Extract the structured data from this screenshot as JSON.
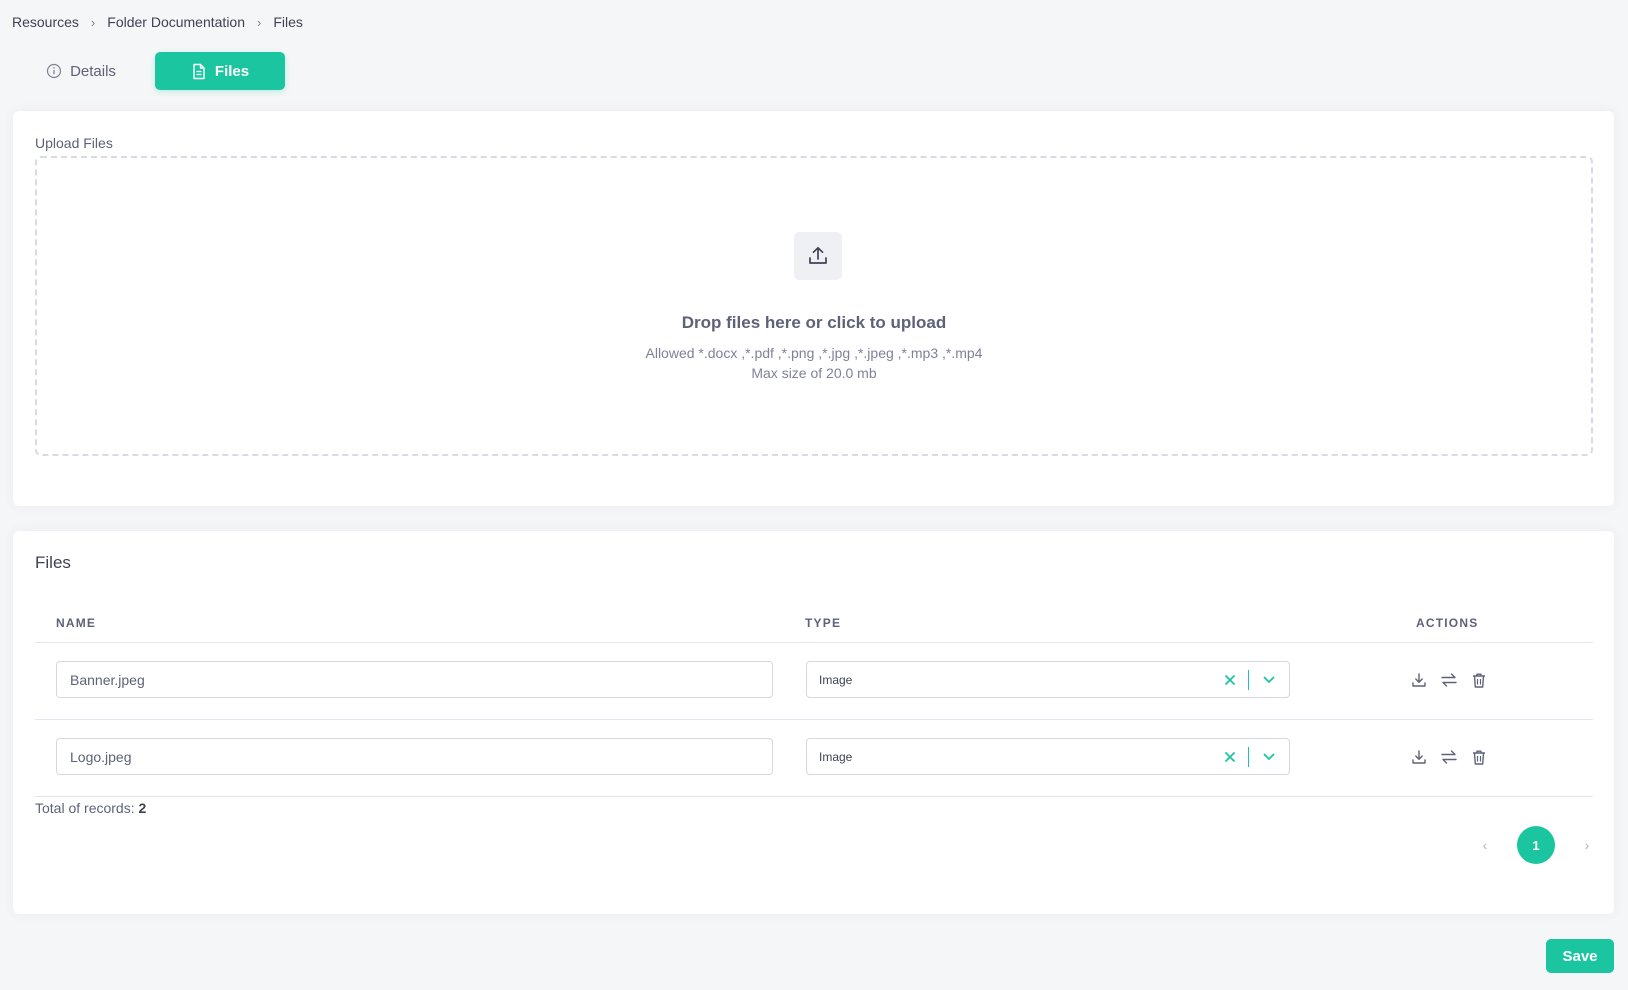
{
  "breadcrumb": {
    "items": [
      "Resources",
      "Folder Documentation",
      "Files"
    ]
  },
  "tabs": {
    "details_label": "Details",
    "files_label": "Files",
    "active": "Files"
  },
  "upload": {
    "label": "Upload Files",
    "title": "Drop files here or click to upload",
    "allowed": "Allowed *.docx ,*.pdf ,*.png ,*.jpg ,*.jpeg ,*.mp3 ,*.mp4",
    "max_size": "Max size of 20.0 mb"
  },
  "files": {
    "title": "Files",
    "columns": [
      "NAME",
      "TYPE",
      "ACTIONS"
    ],
    "rows": [
      {
        "name": "Banner.jpeg",
        "type": "Image"
      },
      {
        "name": "Logo.jpeg",
        "type": "Image"
      }
    ],
    "total_label": "Total of records:",
    "total_count": "2",
    "current_page": "1",
    "prev_icon": "chevron-left-icon",
    "next_icon": "chevron-right-icon"
  },
  "save_label": "Save",
  "colors": {
    "accent": "#1bc5a0",
    "background": "#f5f6f8",
    "text": "#3f4254"
  }
}
